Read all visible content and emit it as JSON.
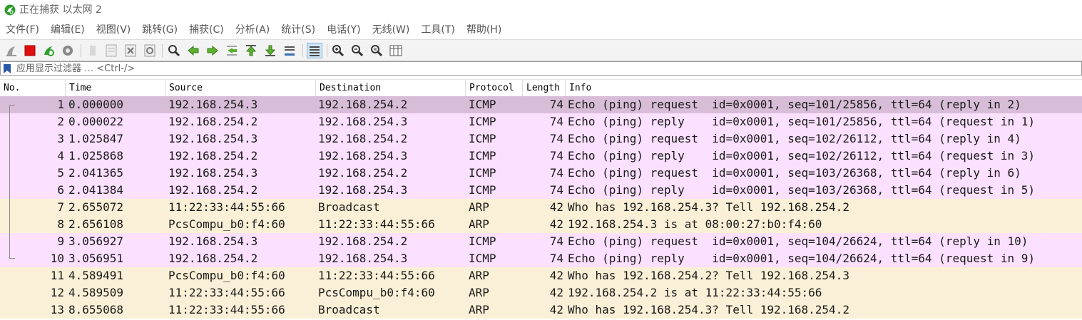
{
  "window": {
    "title": "正在捕获 以太网 2",
    "icon": "wireshark-shark-fin-icon"
  },
  "menu": [
    "文件(F)",
    "编辑(E)",
    "视图(V)",
    "跳转(G)",
    "捕获(C)",
    "分析(A)",
    "统计(S)",
    "电话(Y)",
    "无线(W)",
    "工具(T)",
    "帮助(H)"
  ],
  "toolbar": {
    "buttons": [
      "start-capture-icon",
      "stop-capture-icon",
      "restart-capture-icon",
      "capture-options-icon",
      "open-file-icon",
      "save-file-icon",
      "close-file-icon",
      "reload-file-icon",
      "find-packet-icon",
      "go-back-icon",
      "go-forward-icon",
      "go-to-packet-icon",
      "go-first-packet-icon",
      "go-last-packet-icon",
      "auto-scroll-icon",
      "colorize-icon",
      "zoom-in-icon",
      "zoom-out-icon",
      "normal-size-icon",
      "resize-columns-icon"
    ]
  },
  "filter": {
    "placeholder": "应用显示过滤器 … <Ctrl-/>",
    "value": ""
  },
  "columns": {
    "no": "No.",
    "time": "Time",
    "source": "Source",
    "destination": "Destination",
    "protocol": "Protocol",
    "length": "Length",
    "info": "Info"
  },
  "colors": {
    "icmp": "#fce0ff",
    "arp": "#faf0d7",
    "selected": "#d7bdd8"
  },
  "packets": [
    {
      "no": "1",
      "time": "0.000000",
      "source": "192.168.254.3",
      "destination": "192.168.254.2",
      "protocol": "ICMP",
      "length": "74",
      "info": "Echo (ping) request  id=0x0001, seq=101/25856, ttl=64 (reply in 2)",
      "kind": "selected"
    },
    {
      "no": "2",
      "time": "0.000022",
      "source": "192.168.254.2",
      "destination": "192.168.254.3",
      "protocol": "ICMP",
      "length": "74",
      "info": "Echo (ping) reply    id=0x0001, seq=101/25856, ttl=64 (request in 1)",
      "kind": "icmp"
    },
    {
      "no": "3",
      "time": "1.025847",
      "source": "192.168.254.3",
      "destination": "192.168.254.2",
      "protocol": "ICMP",
      "length": "74",
      "info": "Echo (ping) request  id=0x0001, seq=102/26112, ttl=64 (reply in 4)",
      "kind": "icmp"
    },
    {
      "no": "4",
      "time": "1.025868",
      "source": "192.168.254.2",
      "destination": "192.168.254.3",
      "protocol": "ICMP",
      "length": "74",
      "info": "Echo (ping) reply    id=0x0001, seq=102/26112, ttl=64 (request in 3)",
      "kind": "icmp"
    },
    {
      "no": "5",
      "time": "2.041365",
      "source": "192.168.254.3",
      "destination": "192.168.254.2",
      "protocol": "ICMP",
      "length": "74",
      "info": "Echo (ping) request  id=0x0001, seq=103/26368, ttl=64 (reply in 6)",
      "kind": "icmp"
    },
    {
      "no": "6",
      "time": "2.041384",
      "source": "192.168.254.2",
      "destination": "192.168.254.3",
      "protocol": "ICMP",
      "length": "74",
      "info": "Echo (ping) reply    id=0x0001, seq=103/26368, ttl=64 (request in 5)",
      "kind": "icmp"
    },
    {
      "no": "7",
      "time": "2.655072",
      "source": "11:22:33:44:55:66",
      "destination": "Broadcast",
      "protocol": "ARP",
      "length": "42",
      "info": "Who has 192.168.254.3? Tell 192.168.254.2",
      "kind": "arp"
    },
    {
      "no": "8",
      "time": "2.656108",
      "source": "PcsCompu_b0:f4:60",
      "destination": "11:22:33:44:55:66",
      "protocol": "ARP",
      "length": "42",
      "info": "192.168.254.3 is at 08:00:27:b0:f4:60",
      "kind": "arp"
    },
    {
      "no": "9",
      "time": "3.056927",
      "source": "192.168.254.3",
      "destination": "192.168.254.2",
      "protocol": "ICMP",
      "length": "74",
      "info": "Echo (ping) request  id=0x0001, seq=104/26624, ttl=64 (reply in 10)",
      "kind": "icmp"
    },
    {
      "no": "10",
      "time": "3.056951",
      "source": "192.168.254.2",
      "destination": "192.168.254.3",
      "protocol": "ICMP",
      "length": "74",
      "info": "Echo (ping) reply    id=0x0001, seq=104/26624, ttl=64 (request in 9)",
      "kind": "icmp"
    },
    {
      "no": "11",
      "time": "4.589491",
      "source": "PcsCompu_b0:f4:60",
      "destination": "11:22:33:44:55:66",
      "protocol": "ARP",
      "length": "42",
      "info": "Who has 192.168.254.2? Tell 192.168.254.3",
      "kind": "arp"
    },
    {
      "no": "12",
      "time": "4.589509",
      "source": "11:22:33:44:55:66",
      "destination": "PcsCompu_b0:f4:60",
      "protocol": "ARP",
      "length": "42",
      "info": "192.168.254.2 is at 11:22:33:44:55:66",
      "kind": "arp"
    },
    {
      "no": "13",
      "time": "8.655068",
      "source": "11:22:33:44:55:66",
      "destination": "Broadcast",
      "protocol": "ARP",
      "length": "42",
      "info": "Who has 192.168.254.3? Tell 192.168.254.2",
      "kind": "arp"
    }
  ]
}
